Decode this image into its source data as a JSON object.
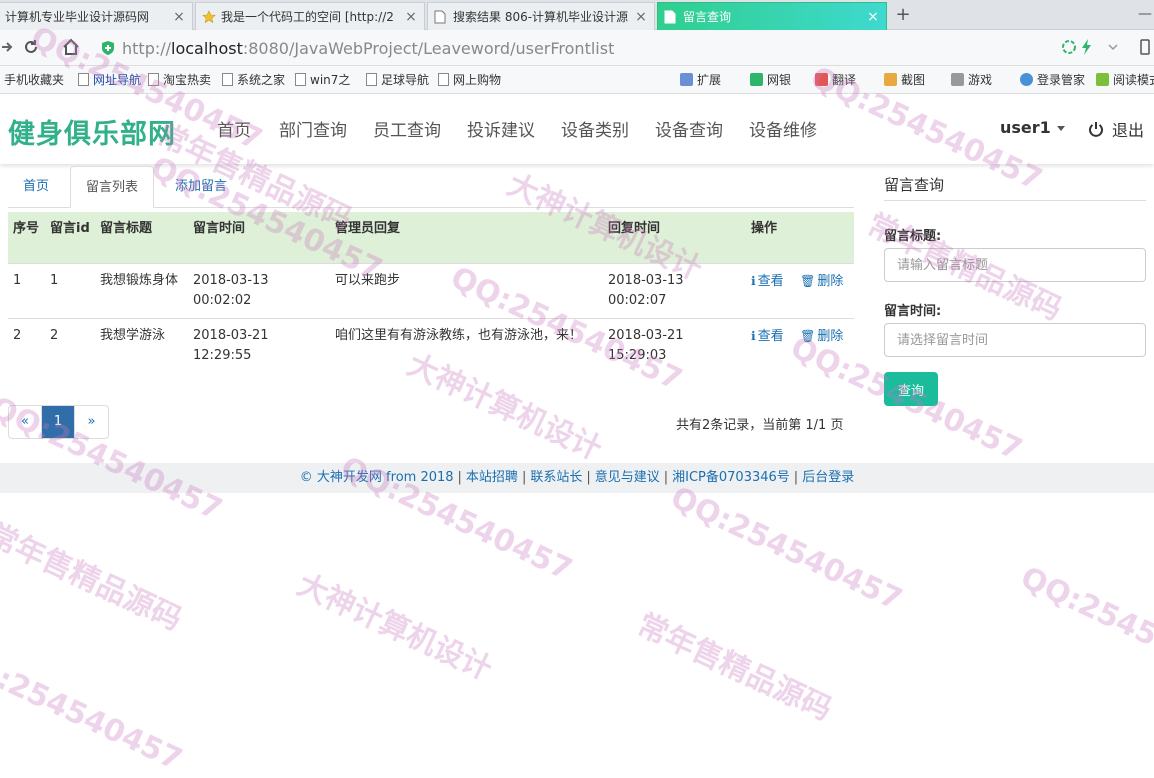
{
  "browser": {
    "tabs": [
      {
        "title": "计算机专业毕业设计源码网"
      },
      {
        "title": "我是一个代码工的空间 [http://2"
      },
      {
        "title": "搜索结果 806-计算机毕业设计源"
      },
      {
        "title": "留言查询"
      }
    ],
    "new_tab": "+",
    "url_prefix": "http://",
    "url_host": "localhost",
    "url_rest": ":8080/JavaWebProject/Leaveword/userFrontlist",
    "bookmarks_left": [
      "手机收藏夹",
      "网址导航",
      "淘宝热卖",
      "系统之家",
      "win7之",
      "足球导航",
      "网上购物"
    ],
    "bookmarks_right": [
      "扩展",
      "网银",
      "翻译",
      "截图",
      "游戏",
      "登录管家",
      "阅读模式"
    ]
  },
  "site": {
    "brand": "健身俱乐部网",
    "nav": [
      "首页",
      "部门查询",
      "员工查询",
      "投诉建议",
      "设备类别",
      "设备查询",
      "设备维修"
    ],
    "user": "user1",
    "logout": "退出"
  },
  "content": {
    "tabs": [
      "首页",
      "留言列表",
      "添加留言"
    ],
    "columns": {
      "seq": "序号",
      "id": "留言id",
      "title": "留言标题",
      "time": "留言时间",
      "reply": "管理员回复",
      "reply_time": "回复时间",
      "ops": "操作"
    },
    "rows": [
      {
        "seq": "1",
        "id": "1",
        "title": "我想锻炼身体",
        "time": "2018-03-13 00:02:02",
        "reply": "可以来跑步",
        "reply_time": "2018-03-13 00:02:07",
        "view": "查看",
        "delete": "删除"
      },
      {
        "seq": "2",
        "id": "2",
        "title": "我想学游泳",
        "time": "2018-03-21 12:29:55",
        "reply": "咱们这里有有游泳教练，也有游泳池，来！",
        "reply_time": "2018-03-21 15:29:03",
        "view": "查看",
        "delete": "删除"
      }
    ],
    "pager": {
      "prev": "«",
      "current": "1",
      "next": "»"
    },
    "page_info": "共有2条记录，当前第 1/1 页"
  },
  "footer": {
    "copyright": "© 大神开发网 from 2018",
    "links": [
      "本站招聘",
      "联系站长",
      "意见与建议",
      "湘ICP备0703346号",
      "后台登录"
    ]
  },
  "sidebar": {
    "title": "留言查询",
    "title_label": "留言标题:",
    "title_placeholder": "请输入留言标题",
    "time_label": "留言时间:",
    "time_placeholder": "请选择留言时间",
    "query_button": "查询"
  },
  "watermark": {
    "texts": [
      "QQ:254540457",
      "大神计算机设计",
      "常年售精品源码"
    ]
  }
}
